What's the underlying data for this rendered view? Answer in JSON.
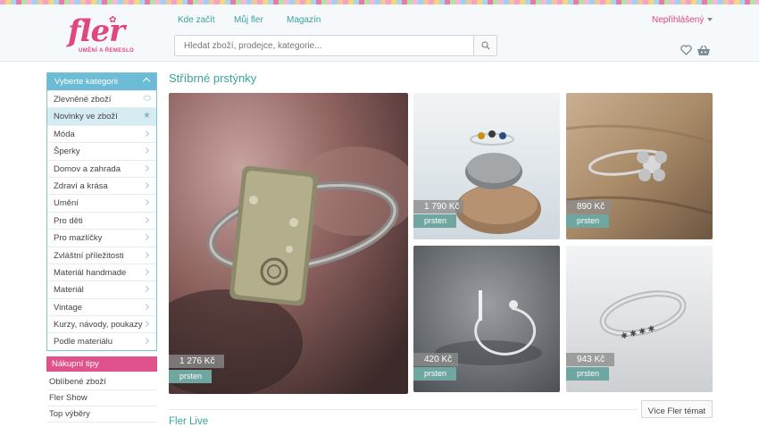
{
  "brand": {
    "name": "fler",
    "tagline": "UMĚNÍ A ŘEMESLO",
    "color": "#e0467f",
    "accent": "#3aa39a"
  },
  "nav": {
    "items": [
      "Kde začít",
      "Můj fler",
      "Magazín"
    ],
    "user": "Nepřihlášený"
  },
  "search": {
    "placeholder": "Hledat zboží, prodejce, kategorie..."
  },
  "sidebar": {
    "header": "Vyberte kategorii",
    "items": [
      {
        "label": "Zlevněné zboží",
        "icon": "tag-icon"
      },
      {
        "label": "Novinky ve zboží",
        "icon": "star-icon"
      },
      {
        "label": "Móda"
      },
      {
        "label": "Šperky"
      },
      {
        "label": "Domov a zahrada"
      },
      {
        "label": "Zdraví a krása"
      },
      {
        "label": "Umění"
      },
      {
        "label": "Pro děti"
      },
      {
        "label": "Pro mazlíčky"
      },
      {
        "label": "Zvláštní příležitosti"
      },
      {
        "label": "Materiál handmade"
      },
      {
        "label": "Materiál"
      },
      {
        "label": "Vintage"
      },
      {
        "label": "Kurzy, návody, poukazy"
      },
      {
        "label": "Podle materiálu"
      }
    ],
    "tips_header": "Nákupní tipy",
    "tips": [
      "Oblíbené zboží",
      "Fler Show",
      "Top výběry"
    ]
  },
  "main": {
    "title": "Stříbrné prstýnky",
    "products": [
      {
        "price": "1 276 Kč",
        "badge": "prsten"
      },
      {
        "price": "1 790 Kč",
        "badge": "prsten"
      },
      {
        "price": "890 Kč",
        "badge": "prsten"
      },
      {
        "price": "420 Kč",
        "badge": "prsten"
      },
      {
        "price": "943 Kč",
        "badge": "prsten"
      }
    ],
    "more_button": "Více Fler témat",
    "next_section": "Fler Live"
  }
}
